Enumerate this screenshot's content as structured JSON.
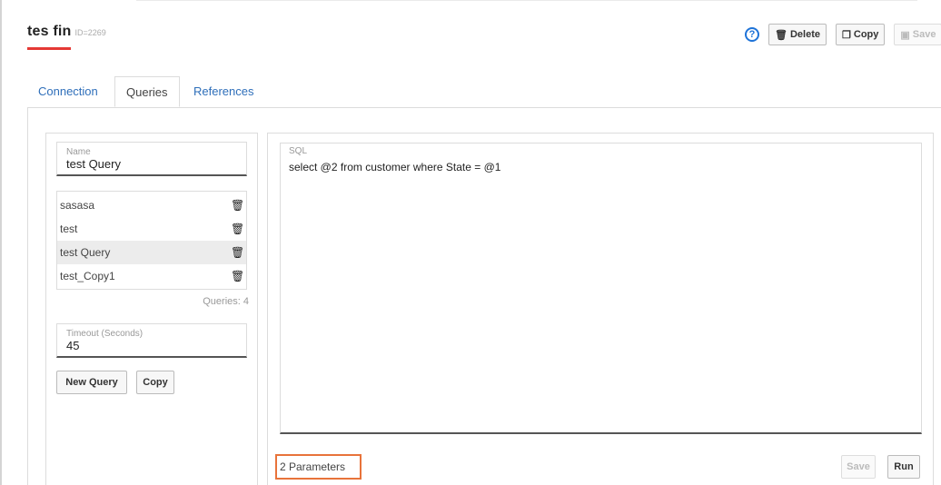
{
  "header": {
    "title": "tes fin",
    "id_label": "ID=2269"
  },
  "toolbar": {
    "help_glyph": "?",
    "delete_label": "Delete",
    "copy_label": "Copy",
    "save_label": "Save"
  },
  "tabs": [
    {
      "label": "Connection",
      "active": false
    },
    {
      "label": "Queries",
      "active": true
    },
    {
      "label": "References",
      "active": false
    }
  ],
  "name_field": {
    "label": "Name",
    "value": "test Query"
  },
  "queries": [
    {
      "label": "sasasa",
      "selected": false
    },
    {
      "label": "test",
      "selected": false
    },
    {
      "label": "test Query",
      "selected": true
    },
    {
      "label": "test_Copy1",
      "selected": false
    }
  ],
  "queries_count_label": "Queries: 4",
  "timeout_field": {
    "label": "Timeout (Seconds)",
    "value": "45"
  },
  "left_buttons": {
    "new_query_label": "New Query",
    "copy_label": "Copy"
  },
  "sql": {
    "label": "SQL",
    "text": "select @2 from customer where State = @1"
  },
  "parameters_label": "2 Parameters",
  "bottom_buttons": {
    "save_label": "Save",
    "run_label": "Run"
  },
  "colors": {
    "accent_red": "#e53935",
    "link_blue": "#2f6fba",
    "help_blue": "#1e73d8",
    "highlight_orange": "#e8733a"
  },
  "icons": {
    "help": "help-circle-icon",
    "delete": "trash-icon",
    "copy": "copy-icon",
    "save": "floppy-disk-icon",
    "query_delete": "trash-icon"
  }
}
